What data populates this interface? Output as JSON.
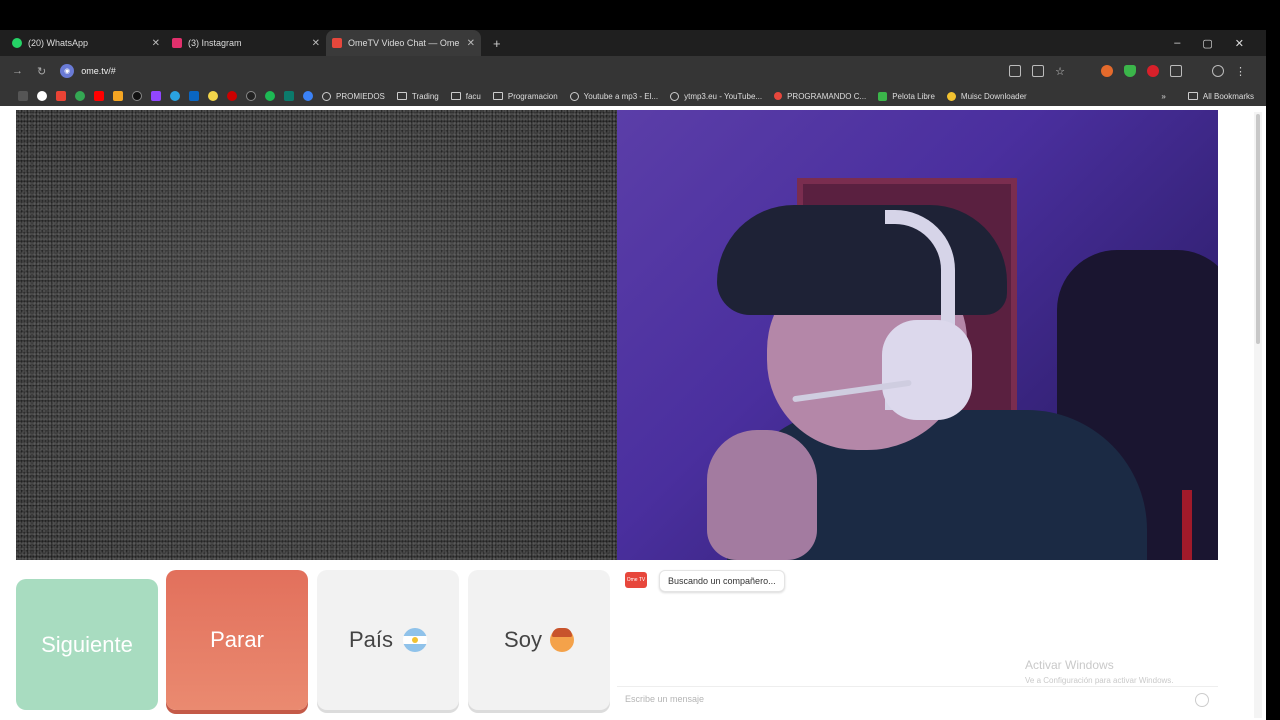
{
  "browser": {
    "tabs": [
      {
        "label": "(20) WhatsApp",
        "color": "#25d366"
      },
      {
        "label": "(3) Instagram",
        "color": "#e1306c"
      },
      {
        "label": "OmeTV Video Chat — Ome",
        "color": "#e7473c"
      }
    ],
    "new_tab": "+",
    "window_controls": {
      "minimize": "–",
      "maximize": "▢",
      "close": "✕"
    },
    "url": "ome.tv/#",
    "bookmarks": [
      {
        "label": "PROMIEDOS",
        "type": "globe"
      },
      {
        "label": "Trading",
        "type": "folder"
      },
      {
        "label": "facu",
        "type": "folder"
      },
      {
        "label": "Programacion",
        "type": "folder"
      },
      {
        "label": "Youtube a mp3 - El...",
        "type": "globe"
      },
      {
        "label": "ytmp3.eu - YouTube...",
        "type": "globe"
      },
      {
        "label": "PROGRAMANDO C...",
        "type": "globe"
      },
      {
        "label": "Pelota Libre",
        "type": "globe"
      },
      {
        "label": "Muisc Downloader",
        "type": "globe"
      }
    ],
    "more_bookmarks": "»",
    "all_bookmarks": "All Bookmarks"
  },
  "controls": {
    "next_label": "Siguiente",
    "stop_label": "Parar",
    "country_label": "País",
    "gender_label": "Soy"
  },
  "chat": {
    "logo_text": "Ome TV",
    "status_message": "Buscando un compañero...",
    "watermark_title": "Activar Windows",
    "watermark_sub": "Ve a Configuración para activar Windows.",
    "input_placeholder": "Escribe un mensaje"
  }
}
